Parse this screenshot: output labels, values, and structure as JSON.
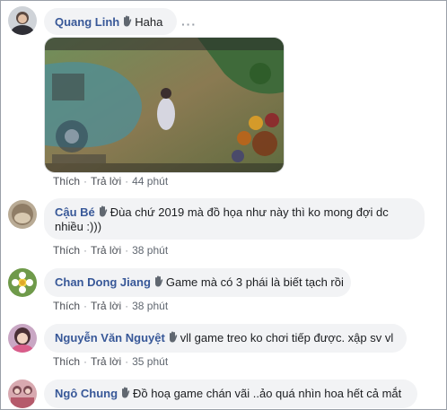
{
  "comments": [
    {
      "name": "Quang Linh",
      "text": "Haha",
      "actions": {
        "like": "Thích",
        "reply": "Trả lời",
        "time": "44 phút"
      },
      "more": "···"
    },
    {
      "name": "Cậu Bé",
      "text": "Đùa chứ 2019 mà đồ họa như này thì ko mong đợi dc",
      "text_line2": "nhiều :)))",
      "actions": {
        "like": "Thích",
        "reply": "Trả lời",
        "time": "38 phút"
      }
    },
    {
      "name": "Chan Dong Jiang",
      "text": "Game mà có 3 phái là biết tạch rồi",
      "actions": {
        "like": "Thích",
        "reply": "Trả lời",
        "time": "38 phút"
      }
    },
    {
      "name": "Nguyễn Văn Nguyệt",
      "text": "vll game treo ko chơi tiếp được. xập sv vl",
      "actions": {
        "like": "Thích",
        "reply": "Trả lời",
        "time": "35 phút"
      }
    },
    {
      "name": "Ngô Chung",
      "text": "Đồ hoạ game chán vãi ..ảo quá nhìn hoa hết cả mắt"
    }
  ],
  "colors": {
    "name": "#385898",
    "bubble": "#f2f3f5",
    "meta": "#606770"
  }
}
